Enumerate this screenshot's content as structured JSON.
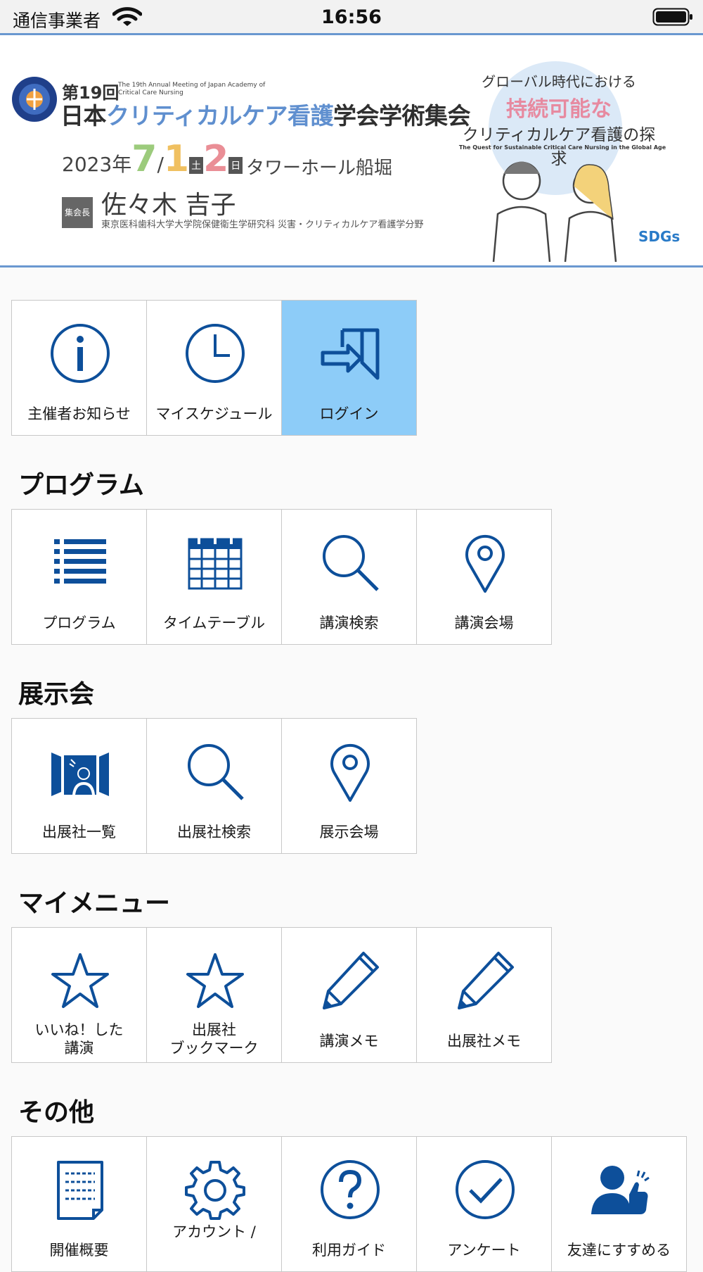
{
  "status": {
    "carrier": "通信事業者",
    "time": "16:56"
  },
  "banner": {
    "edition": "第19回",
    "edition_en": "The 19th Annual Meeting of Japan Academy of Critical Care Nursing",
    "title_a": "日本",
    "title_b": "クリティカルケア看護",
    "title_c": "学会学術集会",
    "year": "2023年",
    "month": "7",
    "slash": "/",
    "day1": "1",
    "day1_w": "土",
    "day2": "2",
    "day2_w": "日",
    "venue": "タワーホール船堀",
    "chair_label": "集会長",
    "chair_name": "佐々木 吉子",
    "affiliation": "東京医科歯科大学大学院保健衛生学研究科 災害・クリティカルケア看護学分野",
    "slogan1": "グローバル時代における",
    "slogan2": "持続可能な",
    "slogan3": "クリティカルケア看護の探求",
    "slogan_en": "The Quest for Sustainable Critical Care Nursing in the Global Age",
    "sdgs": "SDGs"
  },
  "top": [
    {
      "label": "主催者お知らせ",
      "icon": "info-icon"
    },
    {
      "label": "マイスケジュール",
      "icon": "clock-icon"
    },
    {
      "label": "ログイン",
      "icon": "login-icon"
    }
  ],
  "program": {
    "title": "プログラム",
    "items": [
      {
        "label": "プログラム",
        "icon": "list-icon"
      },
      {
        "label": "タイムテーブル",
        "icon": "calendar-icon"
      },
      {
        "label": "講演検索",
        "icon": "search-icon"
      },
      {
        "label": "講演会場",
        "icon": "map-pin-icon"
      }
    ]
  },
  "exhibition": {
    "title": "展示会",
    "items": [
      {
        "label": "出展社一覧",
        "icon": "exhibitor-icon"
      },
      {
        "label": "出展社検索",
        "icon": "search-icon"
      },
      {
        "label": "展示会場",
        "icon": "map-pin-icon"
      }
    ]
  },
  "mymenu": {
    "title": "マイメニュー",
    "items": [
      {
        "line1": "いいね！した",
        "line2": "講演",
        "icon": "star-icon"
      },
      {
        "line1": "出展社",
        "line2": "ブックマーク",
        "icon": "star-icon"
      },
      {
        "label": "講演メモ",
        "icon": "pencil-icon"
      },
      {
        "label": "出展社メモ",
        "icon": "pencil-icon"
      }
    ]
  },
  "other": {
    "title": "その他",
    "items": [
      {
        "label": "開催概要",
        "icon": "document-icon"
      },
      {
        "label": "アカウント /",
        "icon": "gear-icon"
      },
      {
        "label": "利用ガイド",
        "icon": "help-icon"
      },
      {
        "label": "アンケート",
        "icon": "check-circle-icon"
      },
      {
        "label": "友達にすすめる",
        "icon": "recommend-icon"
      }
    ]
  },
  "colors": {
    "icon": "#0d4f9a",
    "active_tile": "#8dccf8",
    "banner_line": "#6a98d0"
  }
}
